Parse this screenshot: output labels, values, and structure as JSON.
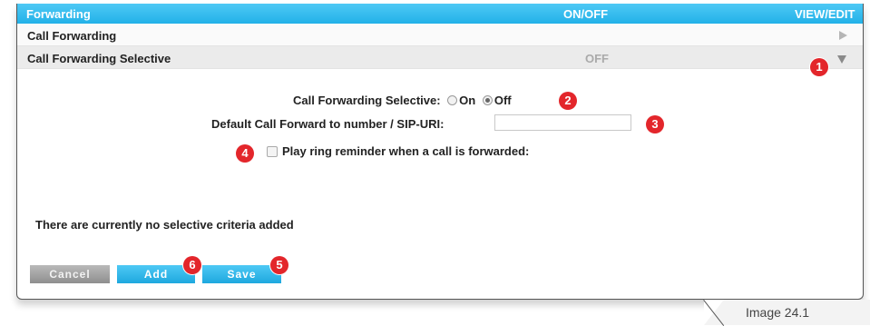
{
  "header": {
    "title": "Forwarding",
    "col_onoff": "ON/OFF",
    "col_viewedit": "VIEW/EDIT"
  },
  "rows": [
    {
      "label": "Call Forwarding",
      "status": "",
      "arrow": "arrow-right-icon"
    },
    {
      "label": "Call Forwarding Selective",
      "status": "OFF",
      "arrow": "arrow-down-icon"
    }
  ],
  "form": {
    "selective_label": "Call Forwarding Selective:",
    "options": [
      {
        "label": "On",
        "checked": false
      },
      {
        "label": "Off",
        "checked": true
      }
    ],
    "forward_label": "Default Call Forward to number / SIP-URI:",
    "forward_value": "",
    "forward_placeholder": "",
    "reminder_label": "Play ring reminder when a call is forwarded:",
    "reminder_checked": false,
    "criteria_message": "There are currently no selective criteria added"
  },
  "buttons": {
    "cancel": "Cancel",
    "add": "Add",
    "save": "Save"
  },
  "callouts": [
    "1",
    "2",
    "3",
    "4",
    "5",
    "6"
  ],
  "caption": "Image 24.1",
  "colors": {
    "accent": "#29b6ec",
    "callout": "#e3262b",
    "cancel": "#a3a3a3"
  }
}
